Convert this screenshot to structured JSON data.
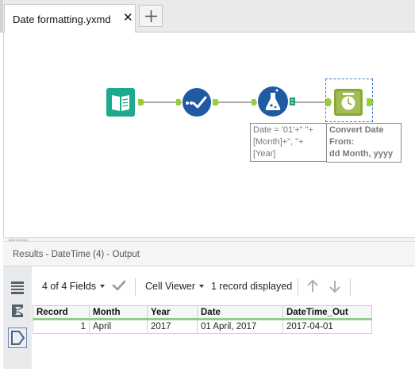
{
  "tab": {
    "title": "Date formatting.yxmd",
    "close": "✕",
    "add": "+"
  },
  "workflow": {
    "tools": [
      {
        "name": "input-data-tool",
        "icon": "book-icon",
        "color": "#1ea88c"
      },
      {
        "name": "select-tool",
        "icon": "checkmark-icon",
        "color": "#1f5aa3"
      },
      {
        "name": "formula-tool",
        "icon": "flask-icon",
        "color": "#1f5aa3"
      },
      {
        "name": "datetime-tool",
        "icon": "clock-icon",
        "color": "#8aa83a"
      }
    ],
    "formula_annotation": {
      "line1": "Date = '01'+\" \"+",
      "line2": "[Month]+\", \"+",
      "line3": "[Year]"
    },
    "datetime_annotation": {
      "line1": "Convert Date",
      "line2": "From:",
      "line3": "dd Month, yyyy"
    }
  },
  "results": {
    "title": "Results - DateTime (4) - Output",
    "fields_label": "4 of 4 Fields",
    "viewer_label": "Cell Viewer",
    "records_label": "1 record displayed",
    "side_icons": [
      "rows-icon",
      "sigma-icon",
      "tag-icon"
    ],
    "table": {
      "columns": [
        "Record",
        "Month",
        "Year",
        "Date",
        "DateTime_Out"
      ],
      "rows": [
        {
          "record": "1",
          "month": "April",
          "year": "2017",
          "date": "01 April, 2017",
          "datetime_out": "2017-04-01"
        }
      ]
    }
  },
  "colors": {
    "connector": "#9acd3b",
    "tabbar": "#e9eaec",
    "header_underline": "#8fce88"
  }
}
